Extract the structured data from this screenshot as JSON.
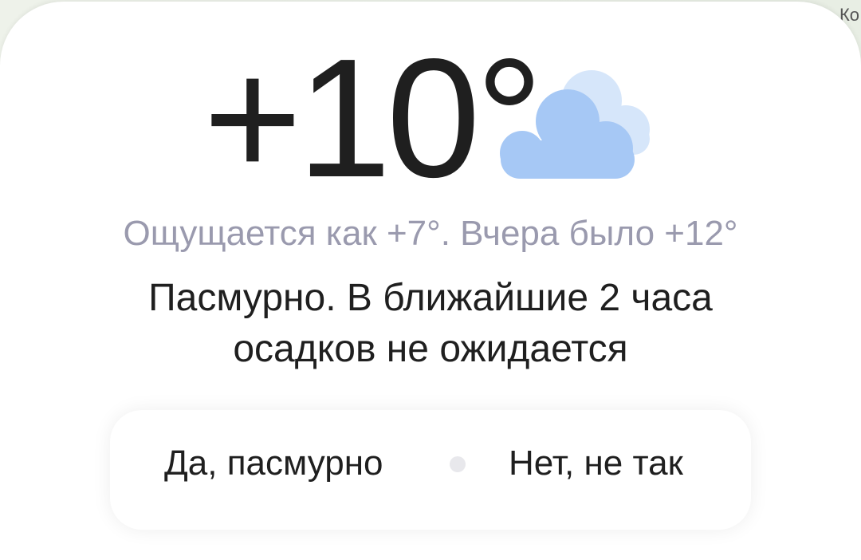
{
  "map": {
    "corner_label": "Ко"
  },
  "weather": {
    "temperature": "+10°",
    "icon": "overcast-cloud-icon",
    "feels_like": "Ощущается как +7°. Вчера было +12°",
    "condition_line1": "Пасмурно. В ближайшие 2 часа",
    "condition_line2": "осадков не ожидается"
  },
  "feedback": {
    "yes_label": "Да, пасмурно",
    "no_label": "Нет, не так"
  },
  "colors": {
    "cloud_front": "#a6c8f5",
    "cloud_back": "#d6e6fa",
    "secondary_text": "#9a9aae",
    "primary_text": "#1f1f1f"
  }
}
